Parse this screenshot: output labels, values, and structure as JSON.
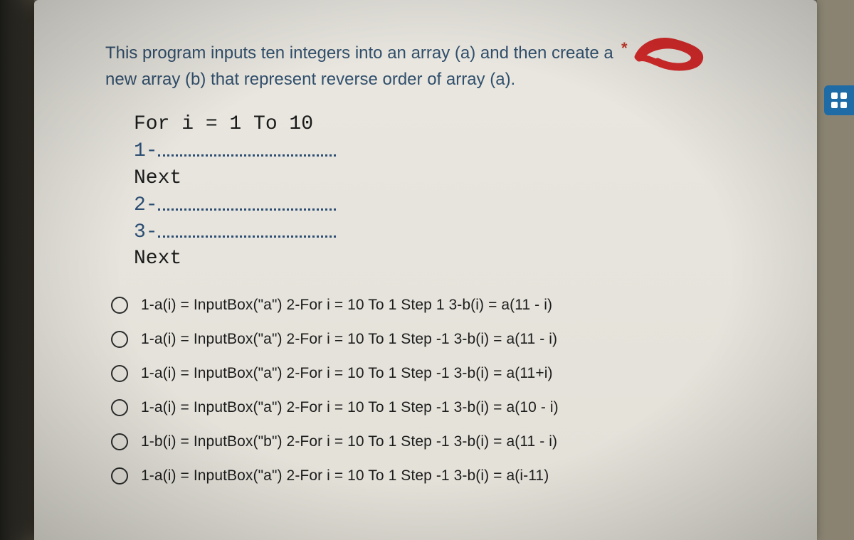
{
  "question": {
    "text": "This program inputs ten integers into an array (a) and then create a new array (b) that represent reverse order of array (a).",
    "required_marker": "*"
  },
  "code": {
    "line1": "For i = 1 To 10",
    "blank1_prefix": "1-",
    "line2": "Next",
    "blank2_prefix": "2-",
    "blank3_prefix": "3-",
    "line3": "Next"
  },
  "options": [
    {
      "label": "1-a(i) = InputBox(\"a\") 2-For i = 10 To 1 Step 1 3-b(i) = a(11 - i)"
    },
    {
      "label": "1-a(i) = InputBox(\"a\") 2-For i = 10 To 1 Step -1 3-b(i) = a(11 - i)"
    },
    {
      "label": "1-a(i) = InputBox(\"a\") 2-For i = 10 To 1 Step -1 3-b(i) = a(11+i)"
    },
    {
      "label": "1-a(i) = InputBox(\"a\") 2-For i = 10 To 1 Step -1 3-b(i) = a(10 - i)"
    },
    {
      "label": "1-b(i) = InputBox(\"b\") 2-For i = 10 To 1 Step -1 3-b(i) = a(11 - i)"
    },
    {
      "label": "1-a(i) = InputBox(\"a\") 2-For i = 10 To 1 Step -1 3-b(i) = a(i-11)"
    }
  ],
  "sidebar": {
    "grid_button_name": "grid-view"
  }
}
